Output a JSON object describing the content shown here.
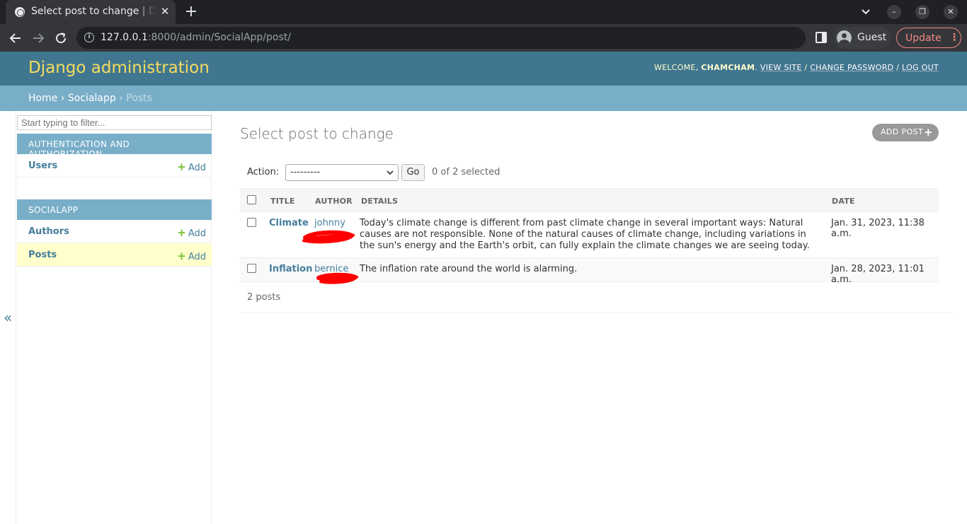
{
  "browser": {
    "tab_title": "Select post to change | Django site admin",
    "tab_close": "✕",
    "new_tab": "+",
    "url_host": "127.0.0.1",
    "url_rest": ":8000/admin/SocialApp/post/",
    "profile_label": "Guest",
    "update_label": "Update",
    "update_menu": "⋮",
    "minimize": "–",
    "restore": "❐",
    "close": "✕"
  },
  "header": {
    "branding": "Django administration",
    "welcome": "WELCOME,",
    "username": "CHAMCHAM",
    "period": ".",
    "view_site": "VIEW SITE",
    "change_password": "CHANGE PASSWORD",
    "log_out": "LOG OUT",
    "sep": "/"
  },
  "breadcrumbs": {
    "home": "Home",
    "app": "Socialapp",
    "current": "Posts",
    "sep": "›"
  },
  "sidebar": {
    "filter_placeholder": "Start typing to filter...",
    "modules": [
      {
        "caption": "AUTHENTICATION AND AUTHORIZATION",
        "models": [
          {
            "name": "Users",
            "add": "Add"
          }
        ]
      },
      {
        "caption": "SOCIALAPP",
        "models": [
          {
            "name": "Authors",
            "add": "Add"
          },
          {
            "name": "Posts",
            "add": "Add"
          }
        ]
      }
    ],
    "plus": "+",
    "collapse": "«"
  },
  "content": {
    "title": "Select post to change",
    "add_button": "ADD POST",
    "add_plus": "+",
    "actions": {
      "label": "Action:",
      "selected_option": "---------",
      "go": "Go",
      "counter": "0 of 2 selected"
    },
    "columns": [
      "TITLE",
      "AUTHOR",
      "DETAILS",
      "DATE"
    ],
    "rows": [
      {
        "title": "Climate",
        "author": "johnny",
        "details": "Today's climate change is different from past climate change in several important ways: Natural causes are not responsible. None of the natural causes of climate change, including variations in the sun's energy and the Earth's orbit, can fully explain the climate changes we are seeing today.",
        "date": "Jan. 31, 2023, 11:38 a.m."
      },
      {
        "title": "Inflation",
        "author": "bernice",
        "details": "The inflation rate around the world is alarming.",
        "date": "Jan. 28, 2023, 11:01 a.m."
      }
    ],
    "paginator": "2 posts"
  },
  "colors": {
    "header_bg": "#417690",
    "branding": "#f5dd5d",
    "breadcrumb_bg": "#79aec8",
    "link": "#447e9b",
    "add_green": "#70bf2b",
    "current_row": "#ffffcc",
    "annotation_red": "#ff0000"
  }
}
